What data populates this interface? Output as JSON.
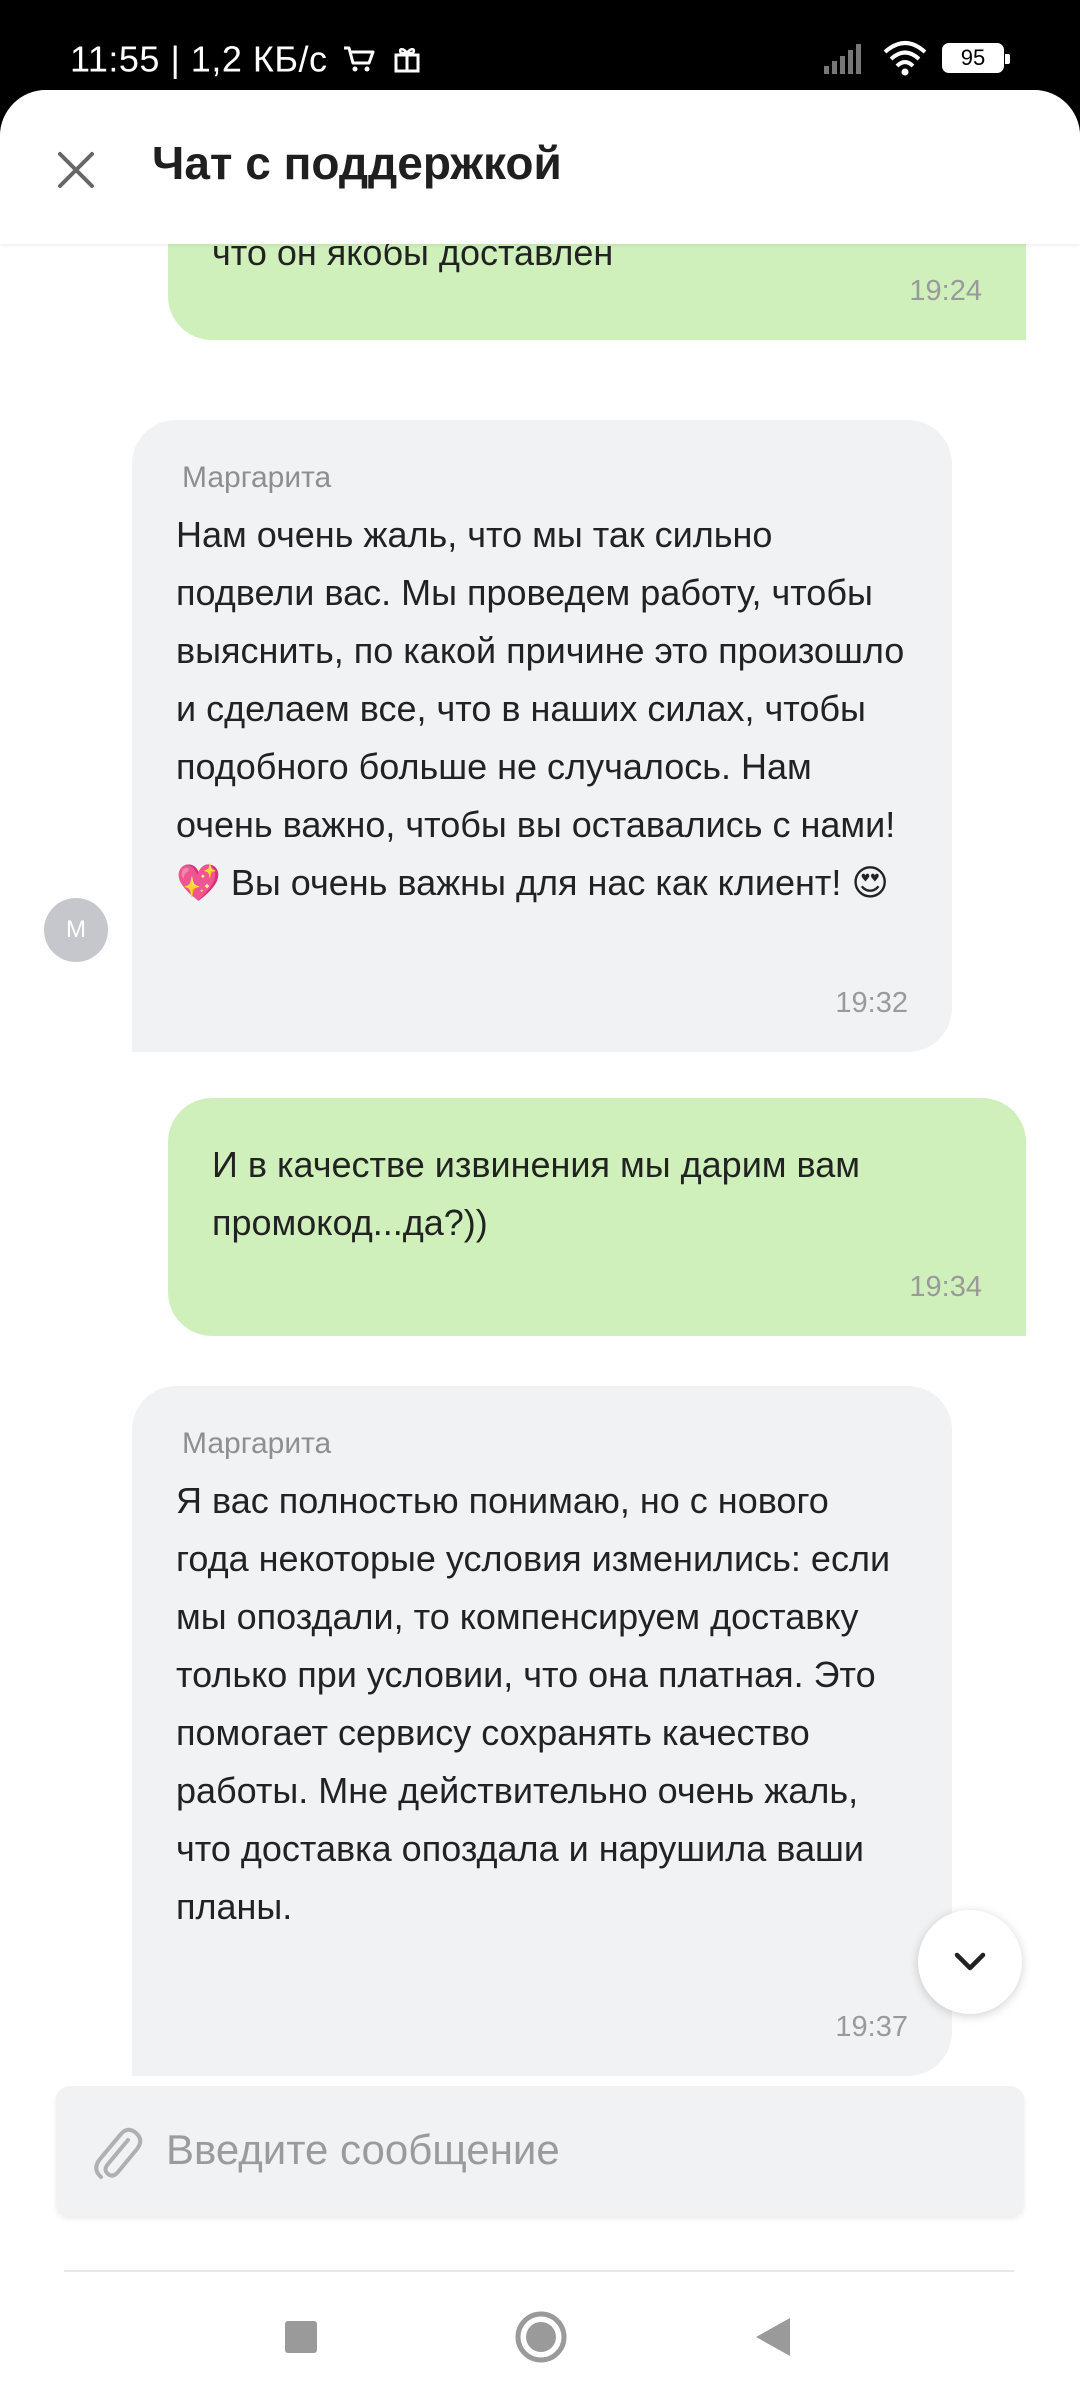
{
  "status_bar": {
    "time": "11:55",
    "speed": "1,2 КБ/с",
    "battery": "95"
  },
  "header": {
    "title": "Чат с поддержкой"
  },
  "messages": [
    {
      "direction": "out",
      "text": "что он якобы доставлен",
      "time": "19:24"
    },
    {
      "direction": "in",
      "sender": "Маргарита",
      "avatar_letter": "М",
      "text": "Нам очень жаль, что мы так сильно подвели вас. Мы проведем работу, чтобы выяснить, по какой причине это произошло и сделаем все, что в наших силах, чтобы подобного больше не случалось. Нам очень важно, чтобы вы оставались с нами!💖 Вы очень важны для нас как клиент! 😍",
      "time": "19:32"
    },
    {
      "direction": "out",
      "text": "И в качестве извинения мы дарим вам промокод...да?))",
      "time": "19:34"
    },
    {
      "direction": "in",
      "sender": "Маргарита",
      "text": "Я вас полностью понимаю, но с нового года некоторые условия изменились: если мы опоздали, то компенсируем доставку только при условии, что она платная. Это помогает сервису сохранять качество работы. Мне действительно очень жаль, что доставка опоздала и нарушила ваши планы.",
      "time": "19:37"
    }
  ],
  "composer": {
    "placeholder": "Введите сообщение"
  },
  "colors": {
    "outgoing_bubble": "#cff0bb",
    "incoming_bubble": "#f1f2f4"
  }
}
